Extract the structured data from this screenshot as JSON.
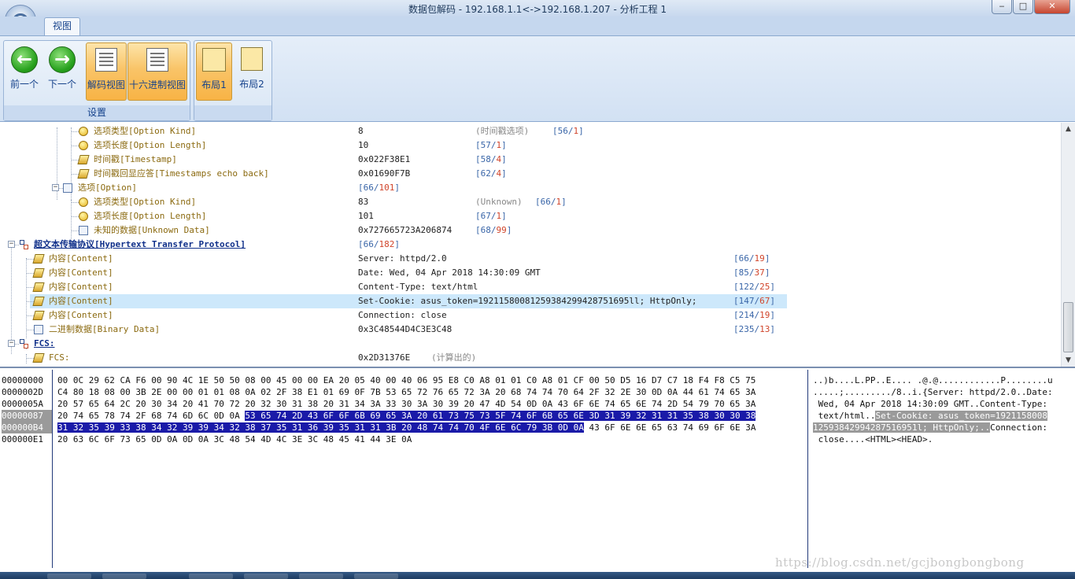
{
  "window": {
    "title": "数据包解码 - 192.168.1.1<->192.168.1.207 - 分析工程 1",
    "minimize": "‒",
    "maximize": "□",
    "close": "✕"
  },
  "ribbon": {
    "tab_label": "视图",
    "group_label": "设置",
    "buttons": {
      "prev": "前一个",
      "next": "下一个",
      "decode_view": "解码视图",
      "hex_view": "十六进制视图",
      "layout1": "布局1",
      "layout2": "布局2"
    }
  },
  "tree": {
    "rows": [
      {
        "label": "选项类型[Option Kind]",
        "value": "8",
        "note": "(时间戳选项)",
        "range_start": "56",
        "range_len": "1",
        "icon": "coin"
      },
      {
        "label": "选项长度[Option Length]",
        "value": "10",
        "note": "",
        "range_start": "57",
        "range_len": "1",
        "icon": "coin"
      },
      {
        "label": "时间戳[Timestamp]",
        "value": "0x022F38E1",
        "note": "",
        "range_start": "58",
        "range_len": "4",
        "icon": "stack"
      },
      {
        "label": "时间戳回显应答[Timestamps echo back]",
        "value": "0x01690F7B",
        "note": "",
        "range_start": "62",
        "range_len": "4",
        "icon": "stack"
      },
      {
        "label": "选项[Option]",
        "value": "",
        "note": "",
        "range_start": "66",
        "range_len": "101",
        "icon": "doc"
      },
      {
        "label": "选项类型[Option Kind]",
        "value": "83",
        "note": "(Unknown)",
        "range_start": "66",
        "range_len": "1",
        "icon": "coin"
      },
      {
        "label": "选项长度[Option Length]",
        "value": "101",
        "note": "",
        "range_start": "67",
        "range_len": "1",
        "icon": "coin"
      },
      {
        "label": "未知的数据[Unknown Data]",
        "value": "0x727665723A206874",
        "note": "",
        "range_start": "68",
        "range_len": "99",
        "icon": "doc"
      },
      {
        "label": "超文本传输协议[Hypertext Transfer Protocol]",
        "value": "",
        "note": "",
        "range_start": "66",
        "range_len": "182",
        "icon": "net"
      },
      {
        "label": "内容[Content]",
        "value": "Server: httpd/2.0",
        "note": "",
        "range_start": "66",
        "range_len": "19",
        "icon": "stack"
      },
      {
        "label": "内容[Content]",
        "value": "Date: Wed, 04 Apr 2018 14:30:09 GMT",
        "note": "",
        "range_start": "85",
        "range_len": "37",
        "icon": "stack"
      },
      {
        "label": "内容[Content]",
        "value": "Content-Type: text/html",
        "note": "",
        "range_start": "122",
        "range_len": "25",
        "icon": "stack"
      },
      {
        "label": "内容[Content]",
        "value": "Set-Cookie: asus_token=19211580081259384299428751695ll; HttpOnly;",
        "note": "",
        "range_start": "147",
        "range_len": "67",
        "icon": "stack"
      },
      {
        "label": "内容[Content]",
        "value": "Connection: close",
        "note": "",
        "range_start": "214",
        "range_len": "19",
        "icon": "stack"
      },
      {
        "label": "二进制数据[Binary Data]",
        "value": "0x3C48544D4C3E3C48",
        "note": "",
        "range_start": "235",
        "range_len": "13",
        "icon": "doc"
      },
      {
        "label": "FCS:",
        "value": "",
        "note": "",
        "range_start": "",
        "range_len": "",
        "icon": "net"
      },
      {
        "label": "FCS:",
        "value": "0x2D31376E",
        "note": "(计算出的)",
        "range_start": "",
        "range_len": "",
        "icon": "stack"
      }
    ]
  },
  "hex": {
    "offsets": [
      "00000000",
      "0000002D",
      "0000005A",
      "00000087",
      "000000B4",
      "000000E1"
    ],
    "lines": [
      {
        "pre": "00 0C 29 62 CA F6 00 90 4C 1E 50 50 08 00 45 00 00 EA 20 05 40 00 40 06 95 E8 C0 A8 01 01 C0 A8 01 CF 00 50 D5 16 D7 C7 18 F4 F8 C5 75",
        "sel": "",
        "post": ""
      },
      {
        "pre": "C4 80 18 08 00 3B 2E 00 00 01 01 08 0A 02 2F 38 E1 01 69 0F 7B 53 65 72 76 65 72 3A 20 68 74 74 70 64 2F 32 2E 30 0D 0A 44 61 74 65 3A",
        "sel": "",
        "post": ""
      },
      {
        "pre": "20 57 65 64 2C 20 30 34 20 41 70 72 20 32 30 31 38 20 31 34 3A 33 30 3A 30 39 20 47 4D 54 0D 0A 43 6F 6E 74 65 6E 74 2D 54 79 70 65 3A",
        "sel": "",
        "post": ""
      },
      {
        "pre": "20 74 65 78 74 2F 68 74 6D 6C 0D 0A ",
        "sel": "53 65 74 2D 43 6F 6F 6B 69 65 3A 20 61 73 75 73 5F 74 6F 6B 65 6E 3D 31 39 32 31 31 35 38 30 30 38",
        "post": ""
      },
      {
        "pre": "",
        "sel": "31 32 35 39 33 38 34 32 39 39 34 32 38 37 35 31 36 39 35 31 31 3B 20 48 74 74 70 4F 6E 6C 79 3B 0D 0A",
        "post": " 43 6F 6E 6E 65 63 74 69 6F 6E 3A"
      },
      {
        "pre": "20 63 6C 6F 73 65 0D 0A 0D 0A 3C 48 54 4D 4C 3E 3C 48 45 41 44 3E 0A",
        "sel": "",
        "post": ""
      }
    ],
    "ascii": [
      {
        "pre": "..)b....L.PP..E.... .@.@............P........u",
        "sel": "",
        "post": ""
      },
      {
        "pre": ".....;........./8..i.{Server: httpd/2.0..Date:",
        "sel": "",
        "post": ""
      },
      {
        "pre": " Wed, 04 Apr 2018 14:30:09 GMT..Content-Type:",
        "sel": "",
        "post": ""
      },
      {
        "pre": " text/html..",
        "sel": "Set-Cookie: asus_token=1921158008",
        "post": ""
      },
      {
        "pre": "",
        "sel": "12593842994287516951l; HttpOnly;..",
        "post": "Connection:"
      },
      {
        "pre": " close....<HTML><HEAD>.",
        "sel": "",
        "post": ""
      }
    ]
  },
  "watermark": "https://blog.csdn.net/gcjbongbongbong",
  "colors": {
    "selection": "#1a1aa8",
    "row_highlight": "#cde8fb",
    "accent": "#f9c468"
  }
}
